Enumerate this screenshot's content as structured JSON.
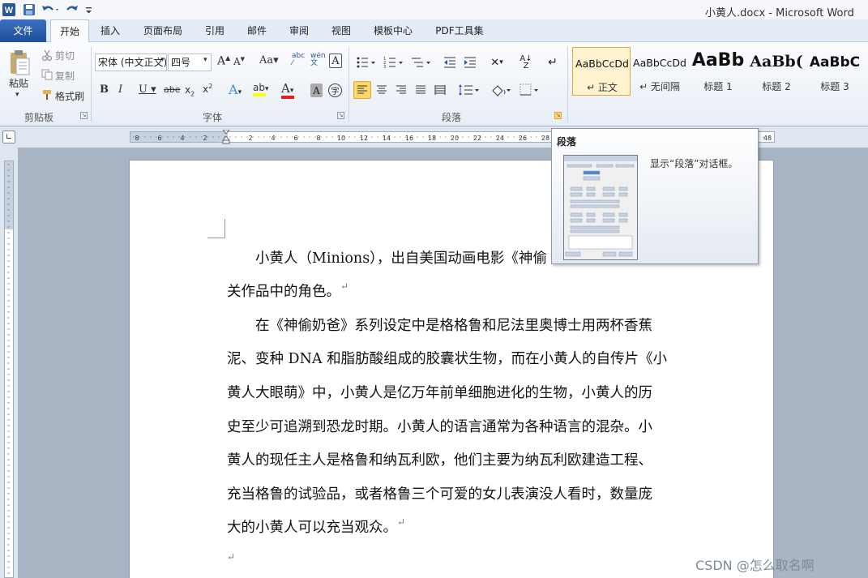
{
  "window": {
    "title": "小黄人.docx - Microsoft Word"
  },
  "quick_access": {
    "icons": [
      "word-app-icon",
      "save-icon",
      "undo-icon",
      "redo-icon",
      "customize-icon"
    ]
  },
  "tabs": {
    "file": "文件",
    "items": [
      "开始",
      "插入",
      "页面布局",
      "引用",
      "邮件",
      "审阅",
      "视图",
      "模板中心",
      "PDF工具集"
    ],
    "active": "开始"
  },
  "ribbon": {
    "clipboard": {
      "label": "剪贴板",
      "paste": "粘贴",
      "cut": "剪切",
      "copy": "复制",
      "format_painter": "格式刷"
    },
    "font": {
      "label": "字体",
      "font_name": "宋体 (中文正文)",
      "font_size": "四号"
    },
    "paragraph": {
      "label": "段落"
    },
    "styles": {
      "items": [
        {
          "sample": "AaBbCcDd",
          "name": "↵ 正文"
        },
        {
          "sample": "AaBbCcDd",
          "name": "↵ 无间隔"
        },
        {
          "sample": "AaBb",
          "name": "标题 1"
        },
        {
          "sample": "AaBb(",
          "name": "标题 2"
        },
        {
          "sample": "AaBbC",
          "name": "标题 3"
        }
      ]
    }
  },
  "ruler": {
    "ticks": [
      "8",
      "6",
      "4",
      "2",
      "2",
      "4",
      "6",
      "8",
      "10",
      "12",
      "14",
      "16",
      "18",
      "20",
      "22",
      "24",
      "26",
      "28",
      "48"
    ]
  },
  "tooltip": {
    "title": "段落",
    "description": "显示“段落”对话框。"
  },
  "document": {
    "paragraphs": [
      [
        "　　小黄人（Minions），出自美国动画电影《神偷",
        "关作品中的角色。"
      ],
      [
        "　　在《神偷奶爸》系列设定中是格格鲁和尼法里奥博士用两杯香蕉",
        "泥、变种 DNA 和脂肪酸组成的胶囊状生物，而在小黄人的自传片《小",
        "黄人大眼萌》中，小黄人是亿万年前单细胞进化的生物，小黄人的历",
        "史至少可追溯到恐龙时期。小黄人的语言通常为各种语言的混杂。小",
        "黄人的现任主人是格鲁和纳瓦利欧，他们主要为纳瓦利欧建造工程、",
        "充当格鲁的试验品，或者格鲁三个可爱的女儿表演没人看时，数量庞",
        "大的小黄人可以充当观众。"
      ]
    ],
    "paragraph_mark": "↵"
  },
  "watermark": "CSDN @怎么取名啊"
}
